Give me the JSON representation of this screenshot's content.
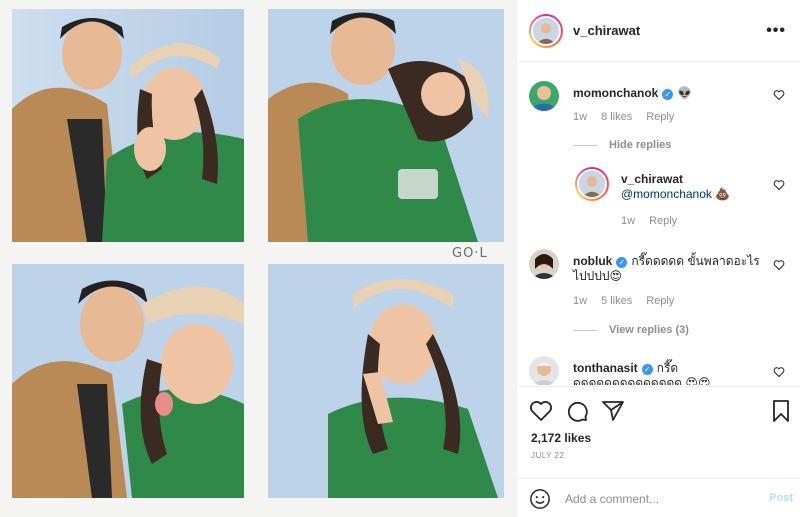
{
  "post": {
    "author": "v_chirawat",
    "more_icon": "more-horizontal-icon",
    "watermark": "GO·L",
    "likes": "2,172 likes",
    "date": "JULY 22"
  },
  "comments": [
    {
      "username": "momonchanok",
      "verified": true,
      "text": "👽",
      "time": "1w",
      "likes": "8 likes",
      "reply": "Reply",
      "toggle": "Hide replies"
    },
    {
      "username": "v_chirawat",
      "verified": false,
      "text": "@momonchanok 💩",
      "time": "1w",
      "reply": "Reply"
    },
    {
      "username": "nobluk",
      "verified": true,
      "text": "กรี๊ดดดดด ขั้นพลาดอะไรไปปปป😍",
      "time": "1w",
      "likes": "5 likes",
      "reply": "Reply",
      "toggle": "View replies (3)"
    },
    {
      "username": "tonthanasit",
      "verified": true,
      "text": "กรี๊ดดดดดดดดดดดดดดด 😍😍"
    }
  ],
  "add_comment": {
    "placeholder": "Add a comment...",
    "post_label": "Post"
  },
  "colors": {
    "accent": "#3897f0",
    "post_disabled": "#b2dffc",
    "meta": "#8e8e8e"
  }
}
